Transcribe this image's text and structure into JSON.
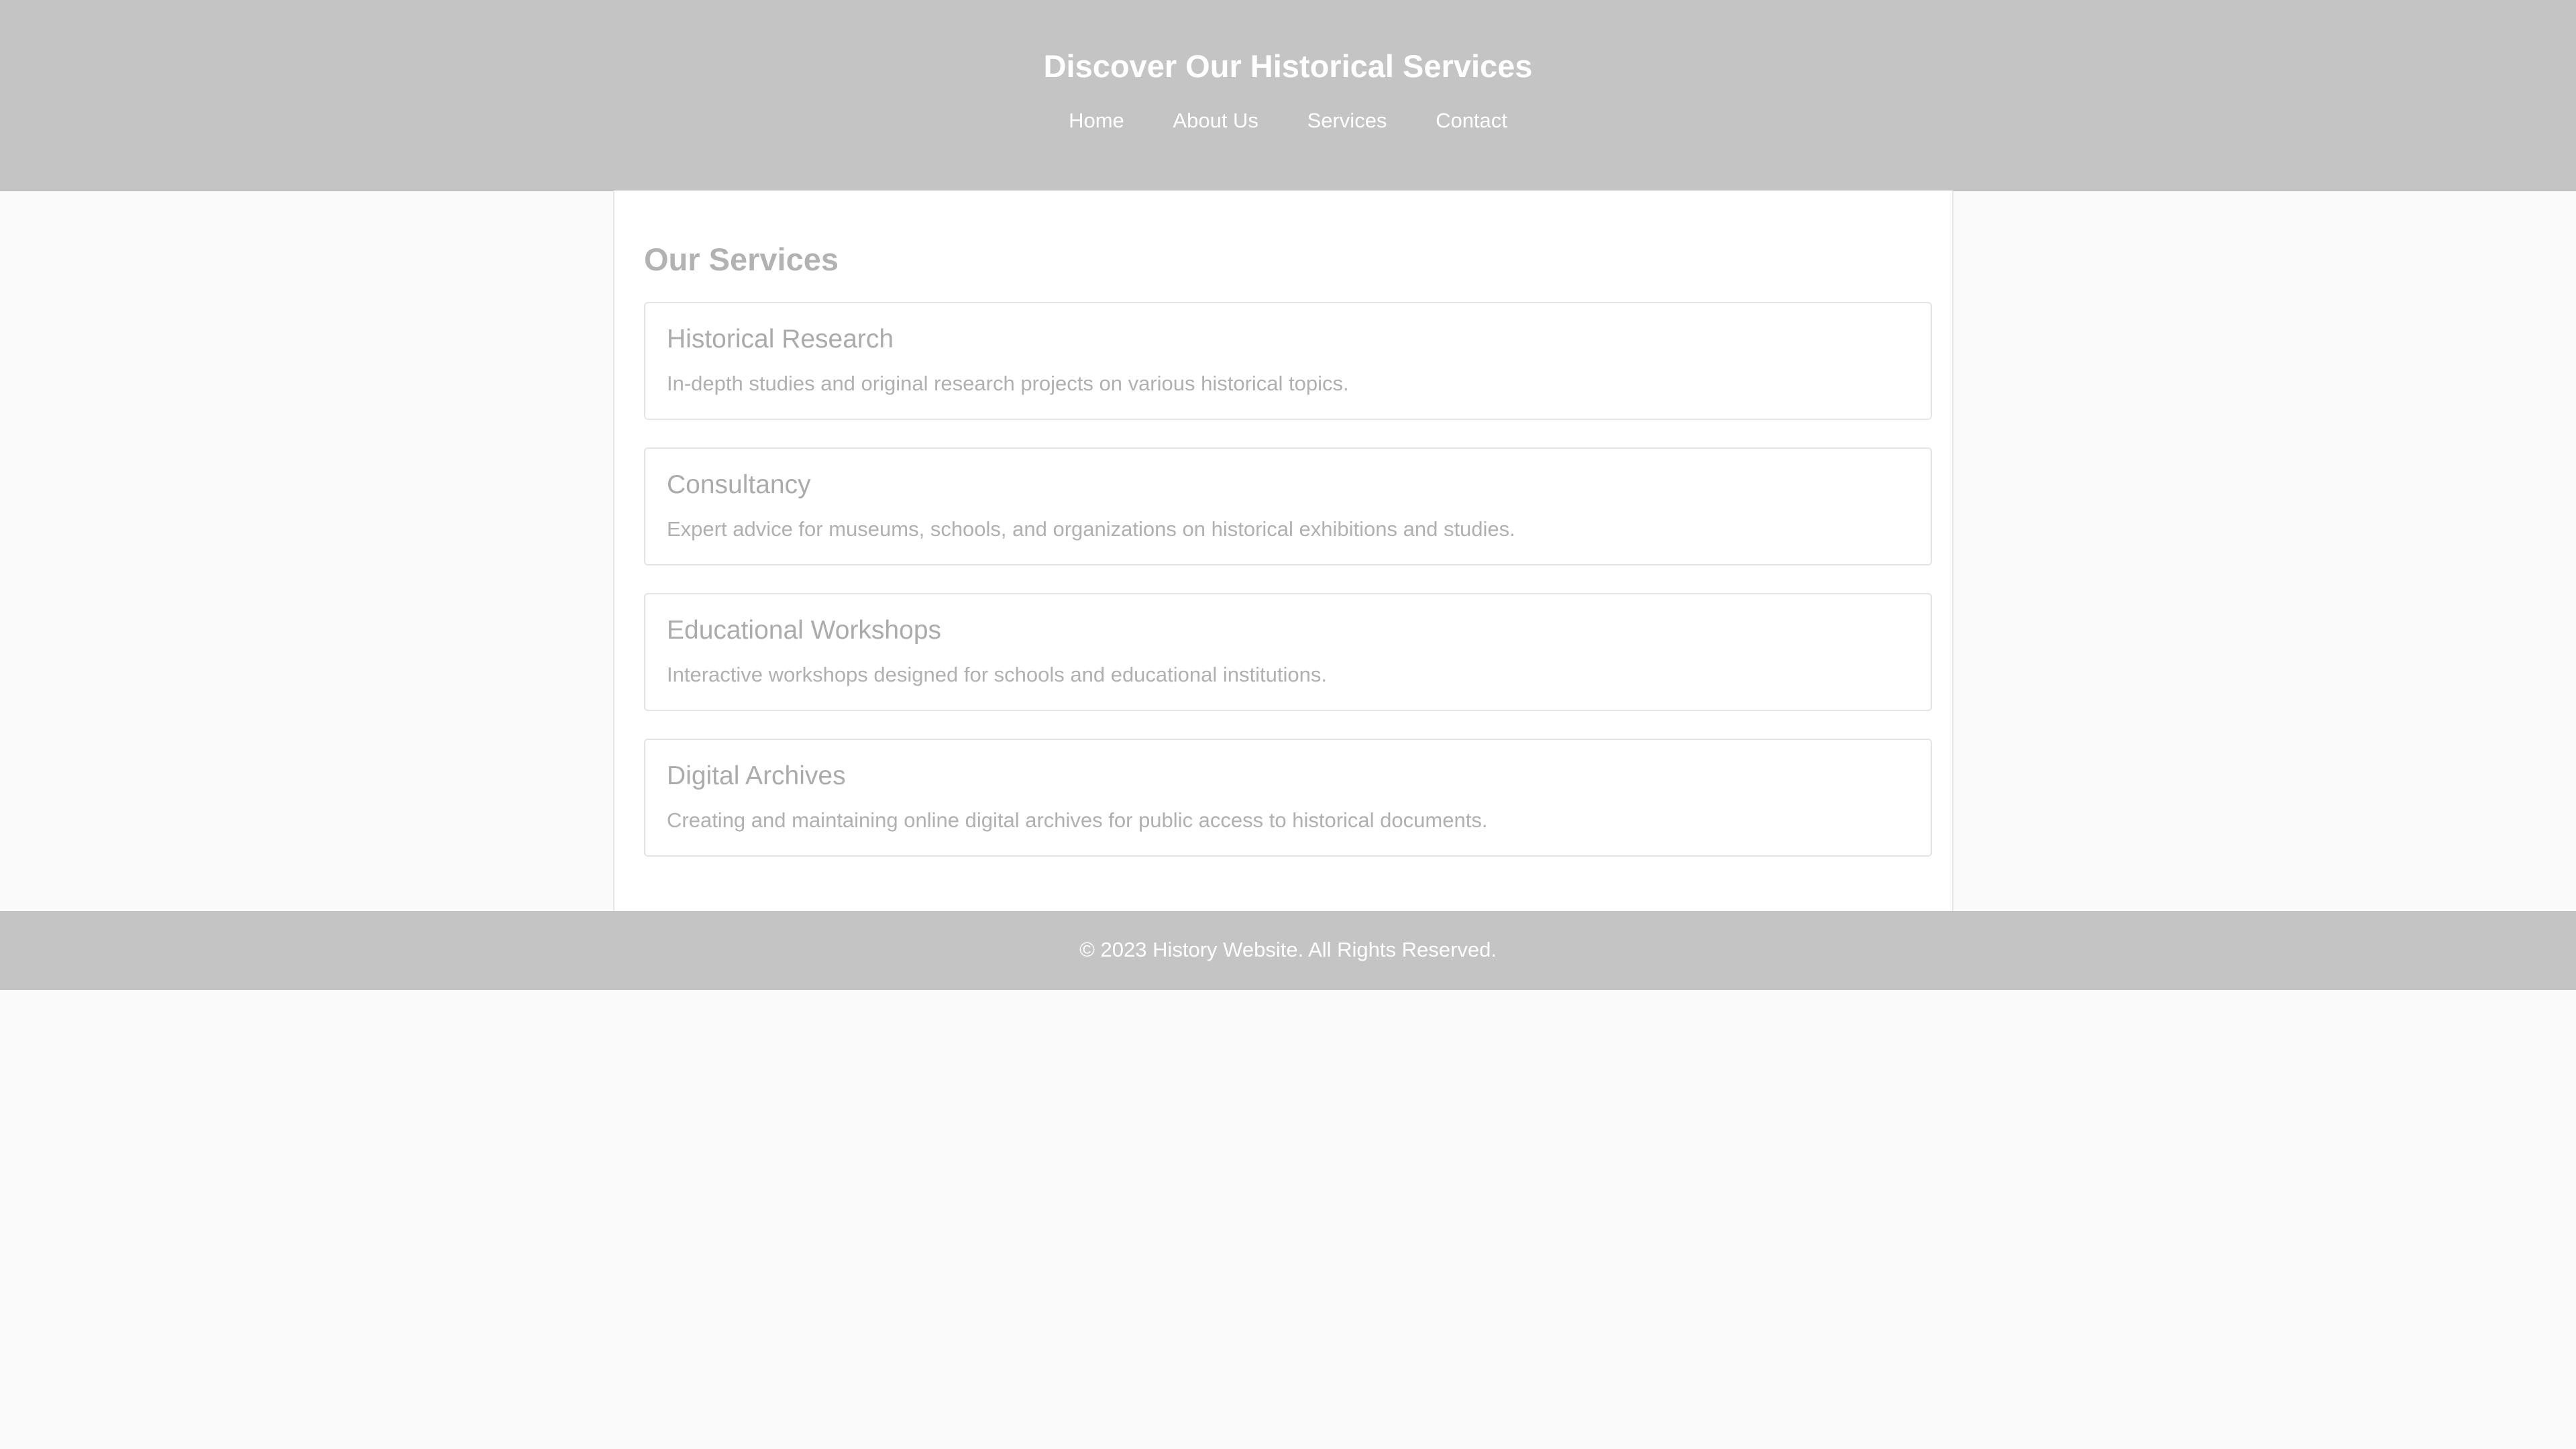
{
  "header": {
    "title": "Discover Our Historical Services",
    "nav": [
      "Home",
      "About Us",
      "Services",
      "Contact"
    ]
  },
  "main": {
    "section_title": "Our Services",
    "services": [
      {
        "title": "Historical Research",
        "description": "In-depth studies and original research projects on various historical topics."
      },
      {
        "title": "Consultancy",
        "description": "Expert advice for museums, schools, and organizations on historical exhibitions and studies."
      },
      {
        "title": "Educational Workshops",
        "description": "Interactive workshops designed for schools and educational institutions."
      },
      {
        "title": "Digital Archives",
        "description": "Creating and maintaining online digital archives for public access to historical documents."
      }
    ]
  },
  "footer": {
    "text": "© 2023 History Website. All Rights Reserved."
  },
  "colors": {
    "header_bg": "#c4c4c4",
    "page_bg": "#fafafa",
    "content_bg": "#ffffff"
  }
}
